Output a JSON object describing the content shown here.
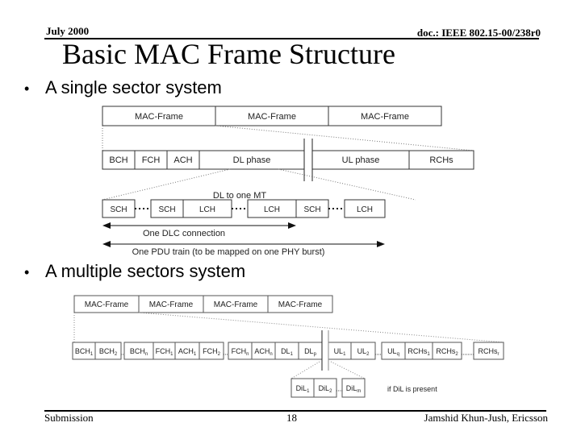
{
  "header": {
    "date": "July 2000",
    "doc_id": "doc.: IEEE 802.15-00/238r0"
  },
  "title": "Basic MAC Frame Structure",
  "bullets": [
    "A single sector system",
    "A multiple sectors system"
  ],
  "single_sector": {
    "mac_frames": [
      "MAC-Frame",
      "MAC-Frame",
      "MAC-Frame"
    ],
    "frame_parts": [
      "BCH",
      "FCH",
      "ACH",
      "DL phase",
      "UL phase",
      "RCHs"
    ],
    "dl_label": "DL to one MT",
    "pdu_cells": [
      "SCH",
      "SCH",
      "LCH",
      "LCH",
      "SCH",
      "LCH"
    ],
    "dlc_label": "One DLC connection",
    "pdu_train_label": "One PDU train (to be mapped on one PHY burst)"
  },
  "multi_sector": {
    "mac_frames": [
      "MAC-Frame",
      "MAC-Frame",
      "MAC-Frame",
      "MAC-Frame"
    ],
    "channels": [
      {
        "base": "BCH",
        "sub": "1"
      },
      {
        "base": "BCH",
        "sub": "2"
      },
      {
        "base": "BCH",
        "sub": "n"
      },
      {
        "base": "FCH",
        "sub": "1"
      },
      {
        "base": "ACH",
        "sub": "1"
      },
      {
        "base": "FCH",
        "sub": "2"
      },
      {
        "base": "FCH",
        "sub": "n"
      },
      {
        "base": "ACH",
        "sub": "n"
      },
      {
        "base": "DL",
        "sub": "1"
      },
      {
        "base": "DL",
        "sub": "p"
      },
      {
        "base": "UL",
        "sub": "1"
      },
      {
        "base": "UL",
        "sub": "2"
      },
      {
        "base": "UL",
        "sub": "q"
      },
      {
        "base": "RCHs",
        "sub": "1"
      },
      {
        "base": "RCHs",
        "sub": "2"
      },
      {
        "base": "RCHs",
        "sub": "r"
      }
    ],
    "dil_cells": [
      {
        "base": "DiL",
        "sub": "1"
      },
      {
        "base": "DiL",
        "sub": "2"
      },
      {
        "base": "DiL",
        "sub": "m"
      }
    ],
    "dil_note": "if DiL is present"
  },
  "footer": {
    "left": "Submission",
    "page": "18",
    "author": "Jamshid Khun-Jush, Ericsson"
  }
}
